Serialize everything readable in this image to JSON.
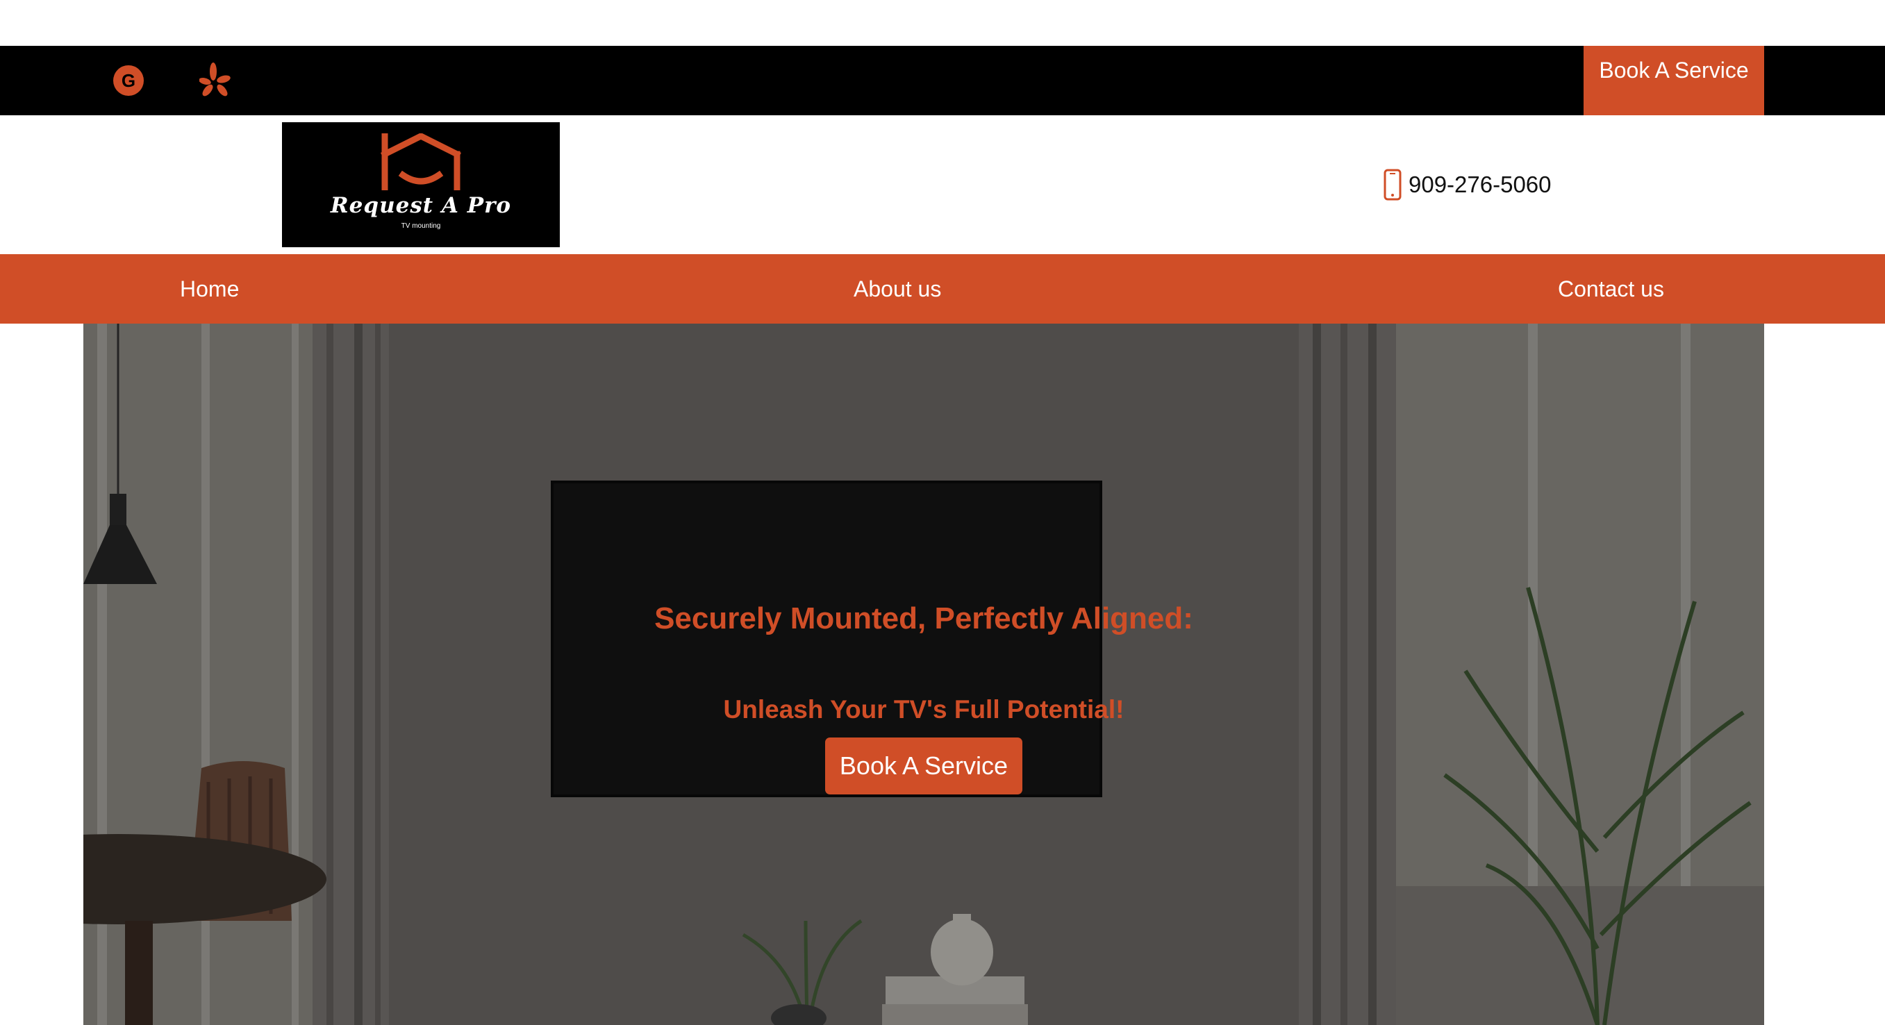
{
  "topbar": {
    "social": [
      {
        "name": "google-icon"
      },
      {
        "name": "yelp-icon"
      }
    ],
    "book_label": "Book A Service"
  },
  "header": {
    "logo": {
      "name": "Request A Pro",
      "tagline": "TV mounting"
    },
    "phone": "909-276-5060"
  },
  "nav": {
    "items": [
      "Home",
      "About us",
      "Contact us"
    ]
  },
  "hero": {
    "headline": "Securely Mounted, Perfectly Aligned:",
    "subheadline": "Unleash Your TV's Full Potential!",
    "cta_label": "Book A Service"
  },
  "colors": {
    "accent": "#d04e27",
    "topbar": "#000000",
    "text": "#111111"
  }
}
